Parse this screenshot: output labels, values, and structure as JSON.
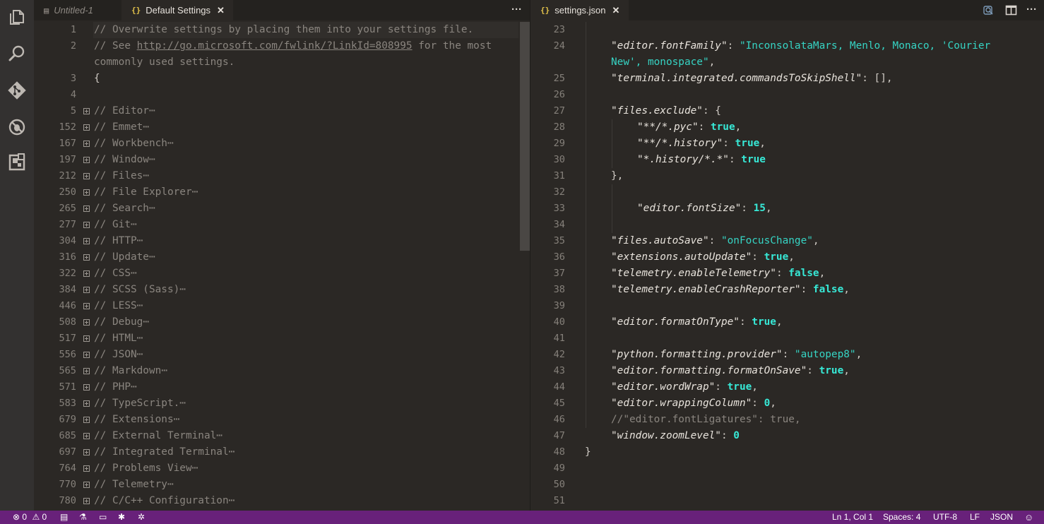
{
  "activity_bar": [
    "explorer-icon",
    "search-icon",
    "git-icon",
    "debug-icon",
    "extensions-icon"
  ],
  "left": {
    "tabs": [
      {
        "label": "Untitled-1",
        "icon": "document-icon"
      },
      {
        "label": "Default Settings",
        "icon": "{}"
      }
    ],
    "more": "···",
    "header_lines": [
      {
        "num": "1",
        "text": "// Overwrite settings by placing them into your settings file."
      },
      {
        "num": "2",
        "pre": "// See ",
        "link": "http://go.microsoft.com/fwlink/?LinkId=808995",
        "post": " for the most"
      },
      {
        "num": "",
        "text": "commonly used settings."
      },
      {
        "num": "3",
        "text": "{"
      },
      {
        "num": "4",
        "text": ""
      }
    ],
    "folded": [
      {
        "num": "5",
        "text": "// Editor"
      },
      {
        "num": "152",
        "text": "// Emmet"
      },
      {
        "num": "167",
        "text": "// Workbench"
      },
      {
        "num": "197",
        "text": "// Window"
      },
      {
        "num": "212",
        "text": "// Files"
      },
      {
        "num": "250",
        "text": "// File Explorer"
      },
      {
        "num": "265",
        "text": "// Search"
      },
      {
        "num": "277",
        "text": "// Git"
      },
      {
        "num": "304",
        "text": "// HTTP"
      },
      {
        "num": "316",
        "text": "// Update"
      },
      {
        "num": "322",
        "text": "// CSS"
      },
      {
        "num": "384",
        "text": "// SCSS (Sass)"
      },
      {
        "num": "446",
        "text": "// LESS"
      },
      {
        "num": "508",
        "text": "// Debug"
      },
      {
        "num": "517",
        "text": "// HTML"
      },
      {
        "num": "556",
        "text": "// JSON"
      },
      {
        "num": "565",
        "text": "// Markdown"
      },
      {
        "num": "571",
        "text": "// PHP"
      },
      {
        "num": "583",
        "text": "// TypeScript."
      },
      {
        "num": "679",
        "text": "// Extensions"
      },
      {
        "num": "685",
        "text": "// External Terminal"
      },
      {
        "num": "697",
        "text": "// Integrated Terminal"
      },
      {
        "num": "764",
        "text": "// Problems View"
      },
      {
        "num": "770",
        "text": "// Telemetry"
      },
      {
        "num": "780",
        "text": "// C/C++ Configuration"
      }
    ],
    "ellipsis": "⋯"
  },
  "right": {
    "tab": {
      "label": "settings.json",
      "icon": "{}"
    },
    "toolbar": [
      "open-changes-icon",
      "split-editor-icon",
      "more-actions-icon"
    ],
    "more": "···",
    "lines": [
      {
        "num": "23",
        "indent": 1,
        "parts": []
      },
      {
        "num": "24",
        "indent": 1,
        "parts": [
          {
            "t": "\"editor.fontFamily\"",
            "c": "key"
          },
          {
            "t": ": ",
            "c": "punc"
          },
          {
            "t": "\"InconsolataMars, Menlo, Monaco, 'Courier",
            "c": "str"
          }
        ]
      },
      {
        "num": "",
        "indent": 1,
        "parts": [
          {
            "t": "New', monospace\"",
            "c": "str"
          },
          {
            "t": ",",
            "c": "punc"
          }
        ]
      },
      {
        "num": "25",
        "indent": 1,
        "parts": [
          {
            "t": "\"terminal.integrated.commandsToSkipShell\"",
            "c": "key"
          },
          {
            "t": ": [],",
            "c": "punc"
          }
        ]
      },
      {
        "num": "26",
        "indent": 1,
        "parts": []
      },
      {
        "num": "27",
        "indent": 1,
        "parts": [
          {
            "t": "\"files.exclude\"",
            "c": "key"
          },
          {
            "t": ": {",
            "c": "punc"
          }
        ]
      },
      {
        "num": "28",
        "indent": 2,
        "parts": [
          {
            "t": "\"**/*.pyc\"",
            "c": "key"
          },
          {
            "t": ": ",
            "c": "punc"
          },
          {
            "t": "true",
            "c": "bool"
          },
          {
            "t": ",",
            "c": "punc"
          }
        ]
      },
      {
        "num": "29",
        "indent": 2,
        "parts": [
          {
            "t": "\"**/*.history\"",
            "c": "key"
          },
          {
            "t": ": ",
            "c": "punc"
          },
          {
            "t": "true",
            "c": "bool"
          },
          {
            "t": ",",
            "c": "punc"
          }
        ]
      },
      {
        "num": "30",
        "indent": 2,
        "parts": [
          {
            "t": "\"*.history/*.*\"",
            "c": "key"
          },
          {
            "t": ": ",
            "c": "punc"
          },
          {
            "t": "true",
            "c": "bool"
          }
        ]
      },
      {
        "num": "31",
        "indent": 1,
        "parts": [
          {
            "t": "},",
            "c": "punc"
          }
        ]
      },
      {
        "num": "32",
        "indent": 1,
        "parts": []
      },
      {
        "num": "33",
        "indent": 2,
        "parts": [
          {
            "t": "\"editor.fontSize\"",
            "c": "key"
          },
          {
            "t": ": ",
            "c": "punc"
          },
          {
            "t": "15",
            "c": "num"
          },
          {
            "t": ",",
            "c": "punc"
          }
        ]
      },
      {
        "num": "34",
        "indent": 1,
        "parts": []
      },
      {
        "num": "35",
        "indent": 1,
        "parts": [
          {
            "t": "\"files.autoSave\"",
            "c": "key"
          },
          {
            "t": ": ",
            "c": "punc"
          },
          {
            "t": "\"onFocusChange\"",
            "c": "str"
          },
          {
            "t": ",",
            "c": "punc"
          }
        ]
      },
      {
        "num": "36",
        "indent": 1,
        "parts": [
          {
            "t": "\"extensions.autoUpdate\"",
            "c": "key"
          },
          {
            "t": ": ",
            "c": "punc"
          },
          {
            "t": "true",
            "c": "bool"
          },
          {
            "t": ",",
            "c": "punc"
          }
        ]
      },
      {
        "num": "37",
        "indent": 1,
        "parts": [
          {
            "t": "\"telemetry.enableTelemetry\"",
            "c": "key"
          },
          {
            "t": ": ",
            "c": "punc"
          },
          {
            "t": "false",
            "c": "bool"
          },
          {
            "t": ",",
            "c": "punc"
          }
        ]
      },
      {
        "num": "38",
        "indent": 1,
        "parts": [
          {
            "t": "\"telemetry.enableCrashReporter\"",
            "c": "key"
          },
          {
            "t": ": ",
            "c": "punc"
          },
          {
            "t": "false",
            "c": "bool"
          },
          {
            "t": ",",
            "c": "punc"
          }
        ]
      },
      {
        "num": "39",
        "indent": 1,
        "parts": []
      },
      {
        "num": "40",
        "indent": 1,
        "parts": [
          {
            "t": "\"editor.formatOnType\"",
            "c": "key"
          },
          {
            "t": ": ",
            "c": "punc"
          },
          {
            "t": "true",
            "c": "bool"
          },
          {
            "t": ",",
            "c": "punc"
          }
        ]
      },
      {
        "num": "41",
        "indent": 1,
        "parts": []
      },
      {
        "num": "42",
        "indent": 1,
        "parts": [
          {
            "t": "\"python.formatting.provider\"",
            "c": "key"
          },
          {
            "t": ": ",
            "c": "punc"
          },
          {
            "t": "\"autopep8\"",
            "c": "str"
          },
          {
            "t": ",",
            "c": "punc"
          }
        ]
      },
      {
        "num": "43",
        "indent": 1,
        "parts": [
          {
            "t": "\"editor.formatting.formatOnSave\"",
            "c": "key"
          },
          {
            "t": ": ",
            "c": "punc"
          },
          {
            "t": "true",
            "c": "bool"
          },
          {
            "t": ",",
            "c": "punc"
          }
        ]
      },
      {
        "num": "44",
        "indent": 1,
        "parts": [
          {
            "t": "\"editor.wordWrap\"",
            "c": "key"
          },
          {
            "t": ": ",
            "c": "punc"
          },
          {
            "t": "true",
            "c": "bool"
          },
          {
            "t": ",",
            "c": "punc"
          }
        ]
      },
      {
        "num": "45",
        "indent": 1,
        "parts": [
          {
            "t": "\"editor.wrappingColumn\"",
            "c": "key"
          },
          {
            "t": ": ",
            "c": "punc"
          },
          {
            "t": "0",
            "c": "num"
          },
          {
            "t": ",",
            "c": "punc"
          }
        ]
      },
      {
        "num": "46",
        "indent": 1,
        "parts": [
          {
            "t": "//\"editor.fontLigatures\": true,",
            "c": "cmt"
          }
        ]
      },
      {
        "num": "47",
        "indent": 1,
        "parts": [
          {
            "t": "\"window.zoomLevel\"",
            "c": "key"
          },
          {
            "t": ": ",
            "c": "punc"
          },
          {
            "t": "0",
            "c": "num"
          }
        ]
      },
      {
        "num": "48",
        "indent": 0,
        "parts": [
          {
            "t": "}",
            "c": "punc"
          }
        ]
      },
      {
        "num": "49",
        "indent": 0,
        "parts": []
      },
      {
        "num": "50",
        "indent": 0,
        "parts": []
      },
      {
        "num": "51",
        "indent": 0,
        "parts": []
      }
    ]
  },
  "status": {
    "errors": "0",
    "warnings": "0",
    "position": "Ln 1, Col 1",
    "spaces": "Spaces: 4",
    "encoding": "UTF-8",
    "eol": "LF",
    "language": "JSON"
  },
  "colors": {
    "status_bar": "#68217a",
    "string": "#36d4c4",
    "bool": "#37e8d6"
  }
}
